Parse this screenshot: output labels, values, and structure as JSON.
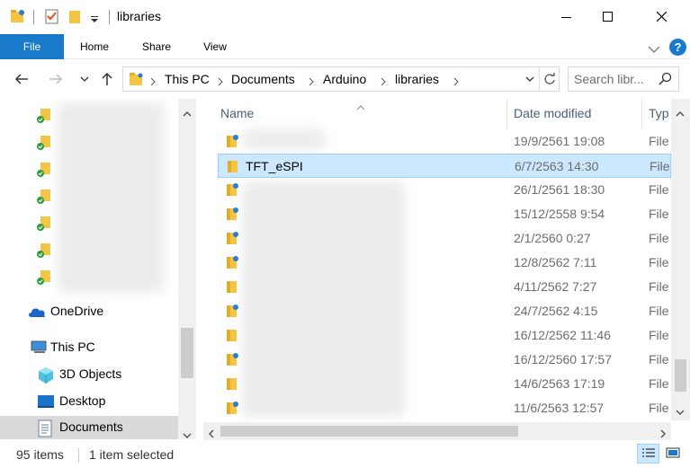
{
  "window": {
    "title": "libraries"
  },
  "ribbon": {
    "tabs": [
      {
        "label": "File"
      },
      {
        "label": "Home"
      },
      {
        "label": "Share"
      },
      {
        "label": "View"
      }
    ],
    "help": "?"
  },
  "address": {
    "crumbs": [
      "This PC",
      "Documents",
      "Arduino",
      "libraries"
    ],
    "search_placeholder": "Search libr..."
  },
  "nav": {
    "onedrive": "OneDrive",
    "this_pc": "This PC",
    "objects3d": "3D Objects",
    "desktop": "Desktop",
    "documents": "Documents"
  },
  "list": {
    "columns": {
      "name": "Name",
      "date": "Date modified",
      "type": "Typ"
    },
    "rows": [
      {
        "name": "",
        "date": "19/9/2561 19:08",
        "type": "File"
      },
      {
        "name": "TFT_eSPI",
        "date": "6/7/2563 14:30",
        "type": "File"
      },
      {
        "name": "",
        "date": "26/1/2561 18:30",
        "type": "File"
      },
      {
        "name": "",
        "date": "15/12/2558 9:54",
        "type": "File"
      },
      {
        "name": "",
        "date": "2/1/2560 0:27",
        "type": "File"
      },
      {
        "name": "",
        "date": "12/8/2562 7:11",
        "type": "File"
      },
      {
        "name": "",
        "date": "4/11/2562 7:27",
        "type": "File"
      },
      {
        "name": "",
        "date": "24/7/2562 4:15",
        "type": "File"
      },
      {
        "name": "",
        "date": "16/12/2562 11:46",
        "type": "File"
      },
      {
        "name": "",
        "date": "16/12/2560 17:57",
        "type": "File"
      },
      {
        "name": "",
        "date": "14/6/2563 17:19",
        "type": "File"
      },
      {
        "name": "",
        "date": "11/6/2563 12:57",
        "type": "File"
      }
    ]
  },
  "status": {
    "items": "95 items",
    "selected": "1 item selected"
  },
  "colors": {
    "accent": "#1979ca",
    "selection": "#cce8ff",
    "folder": "#f4c542"
  }
}
